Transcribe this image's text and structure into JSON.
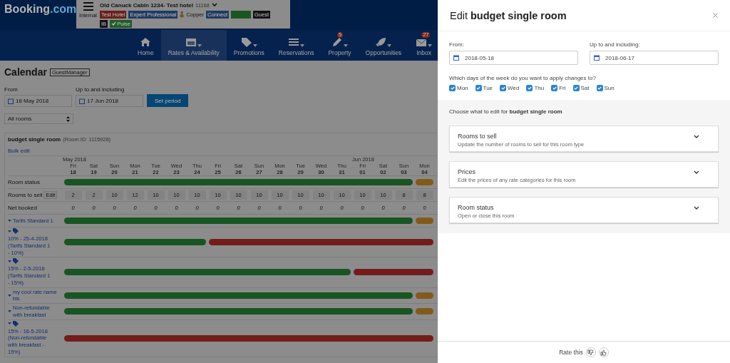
{
  "header": {
    "logo_main": "Booking",
    "logo_suffix": ".com",
    "menu_label": "Internal",
    "hotel_name": "Old Canuck Cabin 1234- Test hotel",
    "hotel_id": "11168",
    "tags": [
      {
        "label": "Test Hotel",
        "color": "#6a1f18"
      },
      {
        "label": "Expert Professional",
        "color": "#203c62"
      }
    ],
    "tier": "Copper",
    "tags_2": [
      {
        "label": "Connect",
        "color": "#203c62"
      },
      {
        "color": "#195722"
      },
      {
        "label": "Guest",
        "color": "#131313"
      }
    ],
    "tags_3": [
      {
        "label": "IB",
        "color": "#131313"
      },
      {
        "label": "Pulse",
        "color": "#205c29",
        "kind": "check"
      }
    ]
  },
  "nav": [
    {
      "label": "Home",
      "selected": false
    },
    {
      "label": "Rates & Availability",
      "selected": true,
      "dropdown": true
    },
    {
      "label": "Promotions",
      "selected": false,
      "dropdown": true
    },
    {
      "label": "Reservations",
      "selected": false,
      "dropdown": true
    },
    {
      "label": "Property",
      "selected": false,
      "dropdown": true,
      "badge": "5"
    },
    {
      "label": "Opportunities",
      "selected": false,
      "dropdown": true
    },
    {
      "label": "Inbox",
      "selected": false,
      "dropdown": true,
      "badge": "27"
    }
  ],
  "calendar": {
    "title": "Calendar",
    "badge": "GuestManager",
    "from_label": "From",
    "from_value": "18 May 2018",
    "to_label": "Up to and including",
    "to_value": "17 Jun 2018",
    "set_button": "Set period",
    "room_filter": "All rooms",
    "room_name": "budget single room",
    "room_id": "(Room ID: 1115928)",
    "bulk_edit": "Bulk edit",
    "days": [
      {
        "dow": "Fri",
        "date": "18",
        "month": "May 2018"
      },
      {
        "dow": "Sat",
        "date": "19"
      },
      {
        "dow": "Sun",
        "date": "20"
      },
      {
        "dow": "Mon",
        "date": "21"
      },
      {
        "dow": "Tue",
        "date": "22"
      },
      {
        "dow": "Wed",
        "date": "23"
      },
      {
        "dow": "Thu",
        "date": "24"
      },
      {
        "dow": "Fri",
        "date": "25"
      },
      {
        "dow": "Sat",
        "date": "26"
      },
      {
        "dow": "Sun",
        "date": "27"
      },
      {
        "dow": "Mon",
        "date": "28"
      },
      {
        "dow": "Tue",
        "date": "29"
      },
      {
        "dow": "Wed",
        "date": "30"
      },
      {
        "dow": "Thu",
        "date": "31"
      },
      {
        "dow": "Fri",
        "date": "01",
        "month": "Jun 2018"
      },
      {
        "dow": "Sat",
        "date": "02"
      },
      {
        "dow": "Sun",
        "date": "03"
      },
      {
        "dow": "Mon",
        "date": "04"
      }
    ],
    "rows": [
      {
        "kind": "status",
        "label": "Room status",
        "days": [
          {
            "color": "#195523"
          },
          {
            "color": "#195523"
          },
          {
            "color": "#195523"
          },
          {
            "color": "#195523"
          },
          {
            "color": "#195523"
          },
          {
            "color": "#195523"
          },
          {
            "color": "#195523"
          },
          {
            "color": "#195523"
          },
          {
            "color": "#195523"
          },
          {
            "color": "#195523"
          },
          {
            "color": "#195523"
          },
          {
            "color": "#195523"
          },
          {
            "color": "#195523"
          },
          {
            "color": "#195523"
          },
          {
            "color": "#195523"
          },
          {
            "color": "#195523"
          },
          {
            "color": "#195523"
          },
          {
            "color": "#835a1a"
          }
        ]
      },
      {
        "kind": "input",
        "label": "Rooms to sell",
        "action": "Edit",
        "values": [
          "2",
          "2",
          "10",
          "12",
          "10",
          "10",
          "10",
          "10",
          "10",
          "10",
          "10",
          "10",
          "10",
          "10",
          "10",
          "10",
          "8",
          "8"
        ]
      },
      {
        "kind": "count",
        "label": "Net booked",
        "values": [
          "0",
          "0",
          "0",
          "0",
          "0",
          "0",
          "0",
          "0",
          "0",
          "0",
          "0",
          "0",
          "0",
          "0",
          "0",
          "0",
          "0",
          "0"
        ]
      },
      {
        "kind": "rate",
        "label": "Tarifs Standard 1",
        "days": [
          {
            "color": "#195523"
          },
          {
            "color": "#195523"
          },
          {
            "color": "#195523"
          },
          {
            "color": "#195523"
          },
          {
            "color": "#195523"
          },
          {
            "color": "#195523"
          },
          {
            "color": "#195523"
          },
          {
            "color": "#195523"
          },
          {
            "color": "#195523"
          },
          {
            "color": "#195523"
          },
          {
            "color": "#195523"
          },
          {
            "color": "#195523"
          },
          {
            "color": "#195523"
          },
          {
            "color": "#195523"
          },
          {
            "color": "#195523"
          },
          {
            "color": "#195523"
          },
          {
            "color": "#195523"
          },
          {
            "color": "#835a1a"
          }
        ]
      },
      {
        "kind": "promotion",
        "label": "10% - 25-4-2018 (Tarifs Standard 1 - 10%)",
        "days": [
          {
            "color": "#195523"
          },
          {
            "color": "#195523"
          },
          {
            "color": "#195523"
          },
          {
            "color": "#195523"
          },
          {
            "color": "#195523"
          },
          {
            "color": "#195523"
          },
          {
            "color": "#195523"
          },
          {
            "color": "#721d1b"
          },
          {
            "color": "#721d1b"
          },
          {
            "color": "#721d1b"
          },
          {
            "color": "#721d1b"
          },
          {
            "color": "#721d1b"
          },
          {
            "color": "#721d1b"
          },
          {
            "color": "#721d1b"
          },
          {
            "color": "#721d1b"
          },
          {
            "color": "#721d1b"
          },
          {
            "color": "#721d1b"
          },
          {
            "color": "#721d1b"
          }
        ]
      },
      {
        "kind": "promotion",
        "label": "15% - 2-5-2018 (Tarifs Standard 1 - 15%)",
        "days": [
          {
            "color": "#195523"
          },
          {
            "color": "#195523"
          },
          {
            "color": "#195523"
          },
          {
            "color": "#195523"
          },
          {
            "color": "#195523"
          },
          {
            "color": "#195523"
          },
          {
            "color": "#195523"
          },
          {
            "color": "#195523"
          },
          {
            "color": "#195523"
          },
          {
            "color": "#195523"
          },
          {
            "color": "#195523"
          },
          {
            "color": "#195523"
          },
          {
            "color": "#195523"
          },
          {
            "color": "#195523"
          },
          {
            "color": "#721d1b"
          },
          {
            "color": "#721d1b"
          },
          {
            "color": "#721d1b"
          },
          {
            "color": "#721d1b"
          }
        ]
      },
      {
        "kind": "rate",
        "label": "my cool rate name bis",
        "days": [
          {
            "color": "#195523"
          },
          {
            "color": "#195523"
          },
          {
            "color": "#195523"
          },
          {
            "color": "#195523"
          },
          {
            "color": "#195523"
          },
          {
            "color": "#195523"
          },
          {
            "color": "#195523"
          },
          {
            "color": "#195523"
          },
          {
            "color": "#195523"
          },
          {
            "color": "#195523"
          },
          {
            "color": "#195523"
          },
          {
            "color": "#195523"
          },
          {
            "color": "#195523"
          },
          {
            "color": "#195523"
          },
          {
            "color": "#195523"
          },
          {
            "color": "#195523"
          },
          {
            "color": "#195523"
          },
          {
            "color": "#835a1a"
          }
        ]
      },
      {
        "kind": "rate",
        "label": "Non-refundable with breakfast",
        "days": [
          {
            "color": "#195523"
          },
          {
            "color": "#195523"
          },
          {
            "color": "#195523"
          },
          {
            "color": "#195523"
          },
          {
            "color": "#195523"
          },
          {
            "color": "#195523"
          },
          {
            "color": "#195523"
          },
          {
            "color": "#195523"
          },
          {
            "color": "#195523"
          },
          {
            "color": "#195523"
          },
          {
            "color": "#195523"
          },
          {
            "color": "#195523"
          },
          {
            "color": "#195523"
          },
          {
            "color": "#195523"
          },
          {
            "color": "#195523"
          },
          {
            "color": "#195523"
          },
          {
            "color": "#195523"
          },
          {
            "color": "#835a1a"
          }
        ]
      },
      {
        "kind": "promotion",
        "label": "15% - 16-5-2018 (Non-refundable with breakfast - 15%)",
        "days": [
          {
            "color": "#721d1b"
          },
          {
            "color": "#721d1b"
          },
          {
            "color": "#721d1b"
          },
          {
            "color": "#721d1b"
          },
          {
            "color": "#721d1b"
          },
          {
            "color": "#721d1b"
          },
          {
            "color": "#721d1b"
          },
          {
            "color": "#721d1b"
          },
          {
            "color": "#721d1b"
          },
          {
            "color": "#721d1b"
          },
          {
            "color": "#721d1b"
          },
          {
            "color": "#721d1b"
          },
          {
            "color": "#721d1b"
          },
          {
            "color": "#721d1b"
          },
          {
            "color": "#721d1b"
          },
          {
            "color": "#721d1b"
          },
          {
            "color": "#721d1b"
          },
          {
            "color": "#721d1b"
          }
        ]
      }
    ]
  },
  "drawer": {
    "title": "Edit **budget single room**",
    "from_label": "From:",
    "from_value": "2018-05-18",
    "to_label": "Up to and including:",
    "to_value": "2018-06-17",
    "days_question": "Which days of the week do you want to apply changes to?",
    "weekdays": [
      {
        "label": "Mon",
        "checked": true
      },
      {
        "label": "Tue",
        "checked": true
      },
      {
        "label": "Wed",
        "checked": true
      },
      {
        "label": "Thu",
        "checked": true
      },
      {
        "label": "Fri",
        "checked": true
      },
      {
        "label": "Sat",
        "checked": true
      },
      {
        "label": "Sun",
        "checked": true
      }
    ],
    "choose_text": "Choose what to edit for **budget single room**",
    "options": [
      {
        "title": "Rooms to sell",
        "description": "Update the number of rooms to sell for this room type",
        "expanded": false
      },
      {
        "title": "Prices",
        "description": "Edit the prices of any rate categories for this room",
        "expanded": false
      },
      {
        "title": "Room status",
        "description": "Open or close this room",
        "expanded": false
      }
    ],
    "rate_label": "Rate this"
  }
}
